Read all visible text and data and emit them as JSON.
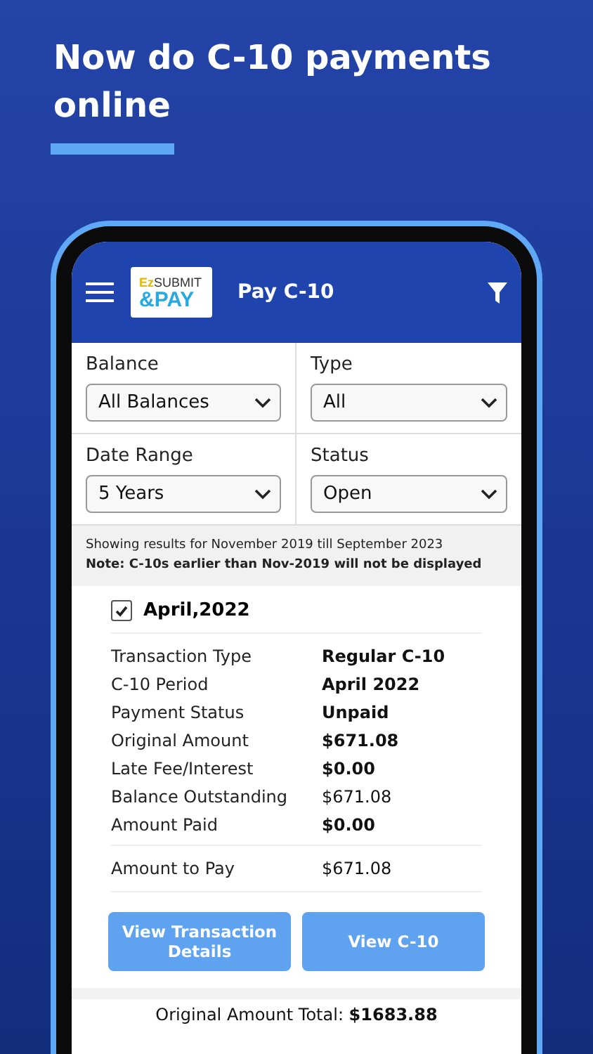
{
  "headline": "Now do C-10 payments online",
  "app_bar": {
    "logo": {
      "prefix": "Ez",
      "line1": "SUBMIT",
      "line2": "&PAY"
    },
    "title": "Pay C-10"
  },
  "filters": [
    {
      "label": "Balance",
      "value": "All Balances"
    },
    {
      "label": "Type",
      "value": "All"
    },
    {
      "label": "Date Range",
      "value": "5 Years"
    },
    {
      "label": "Status",
      "value": "Open"
    }
  ],
  "notice": {
    "range": "Showing results for November 2019 till September 2023",
    "note": "Note: C-10s earlier than Nov-2019 will not be displayed"
  },
  "record": {
    "title": "April,2022",
    "checked": true,
    "rows": [
      {
        "label": "Transaction Type",
        "value": "Regular C-10",
        "emphasized": true
      },
      {
        "label": "C-10 Period",
        "value": "April 2022",
        "emphasized": true
      },
      {
        "label": "Payment Status",
        "value": "Unpaid",
        "emphasized": true
      },
      {
        "label": "Original Amount",
        "value": "$671.08",
        "emphasized": true
      },
      {
        "label": "Late Fee/Interest",
        "value": "$0.00",
        "emphasized": true
      },
      {
        "label": "Balance Outstanding",
        "value": "$671.08",
        "emphasized": false
      },
      {
        "label": "Amount Paid",
        "value": "$0.00",
        "emphasized": true
      }
    ],
    "amount_to_pay": {
      "label": "Amount to Pay",
      "value": "$671.08"
    },
    "buttons": [
      "View Transaction Details",
      "View C-10"
    ]
  },
  "total": "Original Amount  Total: **$1683.88**"
}
